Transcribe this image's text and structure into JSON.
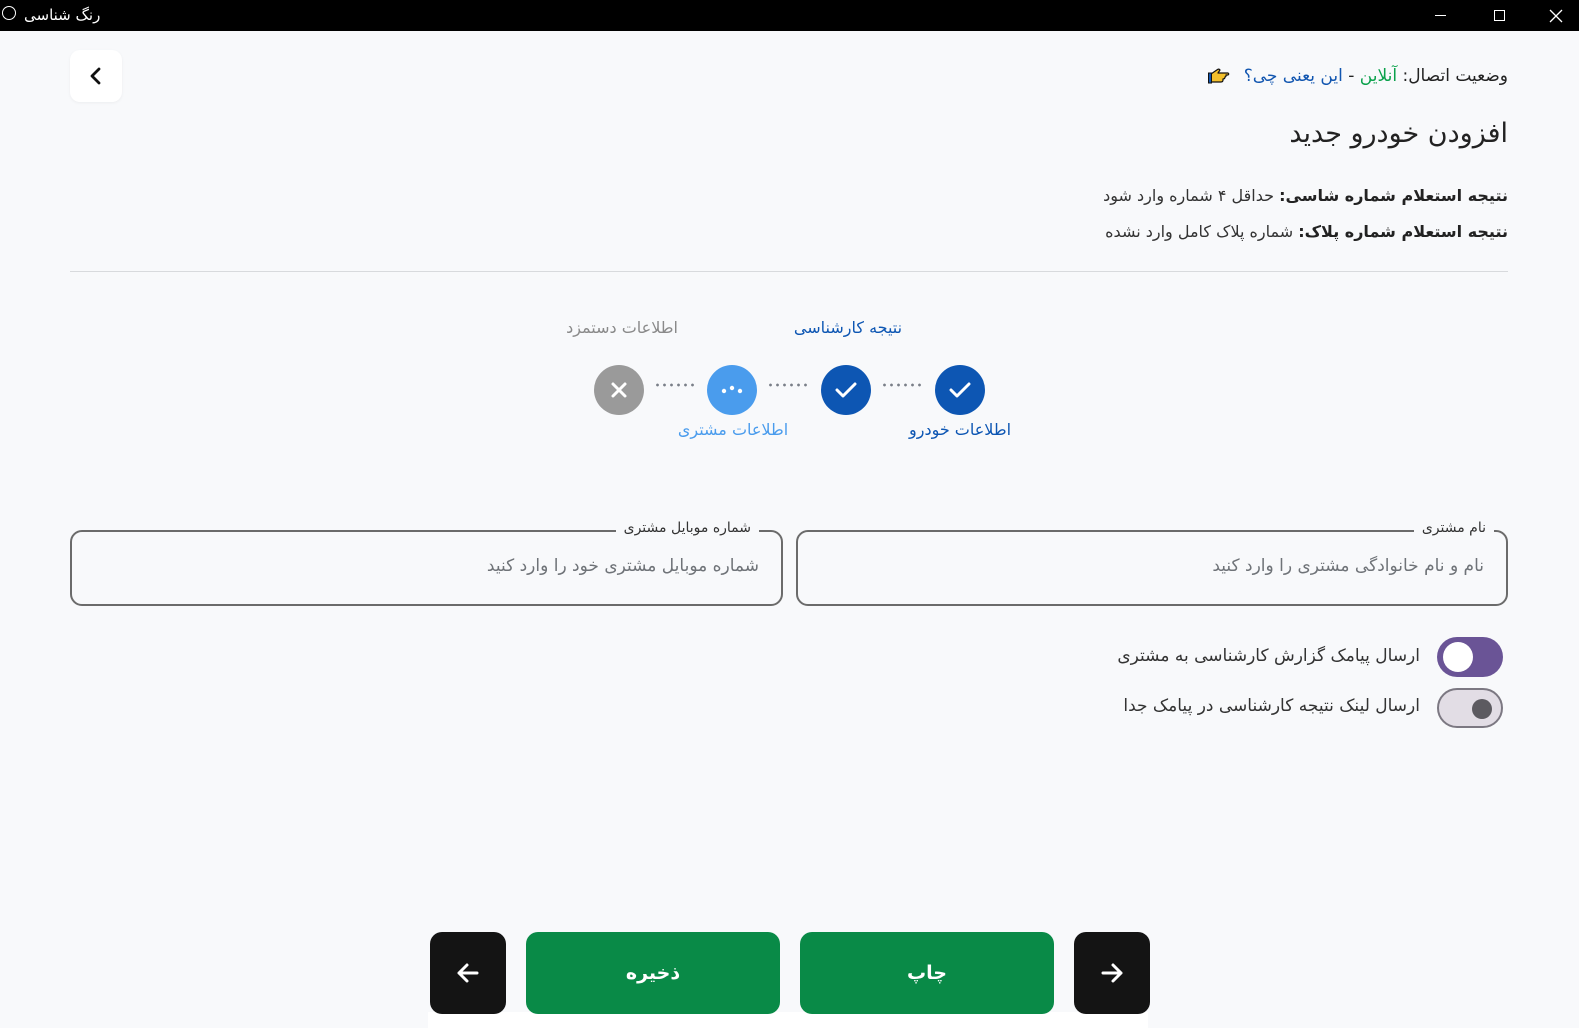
{
  "window": {
    "title": "رنگ شناسی"
  },
  "status": {
    "prefix": "وضعیت اتصال:",
    "state": "آنلاین",
    "separator": "-",
    "help_link": "این یعنی چی؟"
  },
  "page": {
    "title": "افزودن خودرو جدید"
  },
  "info": {
    "chassis_label": "نتیجه استعلام شماره شاسی:",
    "chassis_value": "حداقل ۴ شماره وارد شود",
    "plate_label": "نتیجه استعلام شماره پلاک:",
    "plate_value": "شماره پلاک کامل وارد نشده"
  },
  "steps": [
    {
      "label": "اطلاعات خودرو",
      "state": "done"
    },
    {
      "label": "نتیجه کارشناسی",
      "state": "done"
    },
    {
      "label": "اطلاعات مشتری",
      "state": "current"
    },
    {
      "label": "اطلاعات دستمزد",
      "state": "error"
    }
  ],
  "form": {
    "customer_name": {
      "label": "نام مشتری",
      "placeholder": "نام و نام خانوادگی مشتری را وارد کنید",
      "value": ""
    },
    "customer_mobile": {
      "label": "شماره موبایل مشتری",
      "placeholder": "شماره موبایل مشتری خود را وارد کنید",
      "value": ""
    }
  },
  "toggles": [
    {
      "label": "ارسال پیامک گزارش کارشناسی به مشتری",
      "on": true
    },
    {
      "label": "ارسال لینک نتیجه کارشناسی در پیامک جدا",
      "on": false
    }
  ],
  "actions": {
    "save_label": "ذخیره",
    "print_label": "چاپ"
  },
  "colors": {
    "primary_blue": "#0d56b3",
    "current_blue": "#4a9ced",
    "error_gray": "#9a9a9a",
    "online_green": "#0aa14b",
    "action_green": "#098a47",
    "toggle_purple": "#6a5496"
  }
}
